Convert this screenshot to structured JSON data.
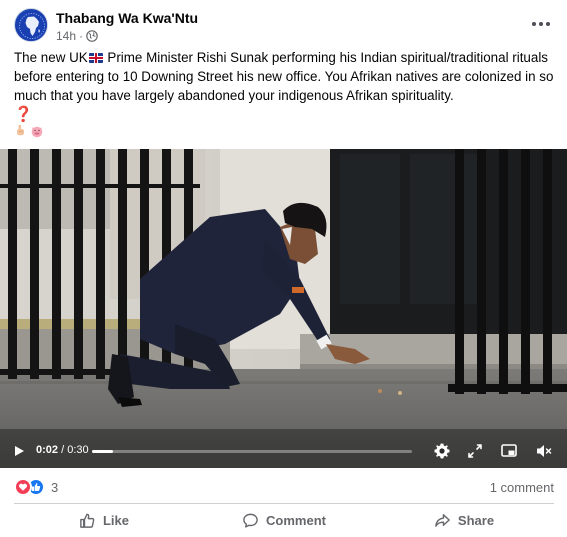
{
  "post": {
    "author": "Thabang Wa Kwa'Ntu",
    "timestamp": "14h",
    "privacy_dot": "·",
    "privacy_icon": "globe-icon",
    "more_icon": "more-options-icon",
    "caption_part1": "The new UK",
    "caption_part2": " Prime Minister Rishi Sunak performing his Indian spiritual/traditional rituals before entering to 10 Downing Street his new office. You Afrikan natives are colonized in so much that you have largely abandoned your indigenous  Afrikan spirituality.",
    "emoji_line1": "❓",
    "emoji_line2_icons": [
      "pointing-finger-icon",
      "pig-face-icon"
    ]
  },
  "video": {
    "current_time": "0:02",
    "separator": " / ",
    "total_time": "0:30",
    "progress": 0.067,
    "icons": [
      "play-icon",
      "settings-gear-icon",
      "fullscreen-icon",
      "picture-in-picture-icon",
      "volume-muted-icon"
    ]
  },
  "engagement": {
    "reaction_icons": [
      "love-reaction-icon",
      "like-reaction-icon"
    ],
    "reaction_count": "3",
    "comments_label": "1 comment"
  },
  "actions": {
    "like_label": "Like",
    "comment_label": "Comment",
    "share_label": "Share"
  },
  "colors": {
    "brand_blue": "#1877f2",
    "love_red": "#f33e58",
    "secondary_text": "#65676b"
  }
}
